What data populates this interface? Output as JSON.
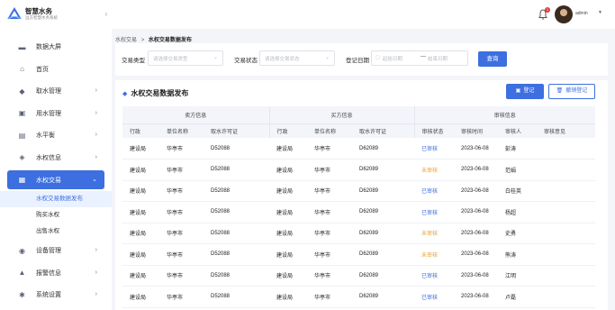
{
  "app": {
    "name": "智慧水务",
    "subtitle": "远方智慧水务系统"
  },
  "sidebar": {
    "items": [
      {
        "label": "数据大屏",
        "icon": "monitor-icon",
        "has_children": false
      },
      {
        "label": "首页",
        "icon": "home-icon",
        "has_children": false
      },
      {
        "label": "取水管理",
        "icon": "water-intake-icon",
        "has_children": true
      },
      {
        "label": "用水管理",
        "icon": "water-use-icon",
        "has_children": true
      },
      {
        "label": "水平衡",
        "icon": "balance-icon",
        "has_children": true
      },
      {
        "label": "水权信息",
        "icon": "water-rights-icon",
        "has_children": true
      },
      {
        "label": "水权交易",
        "icon": "trade-icon",
        "has_children": true,
        "active": true
      },
      {
        "label": "设备管理",
        "icon": "device-icon",
        "has_children": true
      },
      {
        "label": "报警信息",
        "icon": "alarm-icon",
        "has_children": true
      },
      {
        "label": "系统设置",
        "icon": "settings-icon",
        "has_children": true
      }
    ],
    "sub_items": [
      "水权交易数据发布",
      "购买水权",
      "出售水权"
    ]
  },
  "topbar": {
    "notification_count": "1",
    "user_name": "admin"
  },
  "breadcrumb": {
    "parent": "水权交易",
    "separator": ">",
    "current": "水权交易数据发布"
  },
  "filters": {
    "trade_type_label": "交易类型",
    "trade_type_placeholder": "请选择交易类型",
    "trade_status_label": "交易状态",
    "trade_status_placeholder": "请选择交易状态",
    "reg_date_label": "登记日期",
    "date_start_placeholder": "起始日期",
    "date_sep": "—",
    "date_end_placeholder": "结束日期",
    "query_label": "查询"
  },
  "panel": {
    "title": "水权交易数据发布",
    "register_label": "登记",
    "cancel_register_label": "撤销登记"
  },
  "table": {
    "group_headers": [
      "卖方信息",
      "买方信息",
      "审核信息"
    ],
    "columns": [
      "行政",
      "单位名称",
      "取水许可证",
      "行政",
      "单位名称",
      "取水许可证",
      "审核状态",
      "审核时间",
      "审核人",
      "审核意见"
    ],
    "rows": [
      [
        "建设局",
        "华亭市",
        "D52088",
        "建设局",
        "华亭市",
        "D62089",
        "已审核",
        "2023-06-08",
        "彭涛",
        ""
      ],
      [
        "建设局",
        "华亭市",
        "D52088",
        "建设局",
        "华亭市",
        "D62089",
        "未审核",
        "2023-06-08",
        "范娟",
        ""
      ],
      [
        "建设局",
        "华亭市",
        "D52088",
        "建设局",
        "华亭市",
        "D62089",
        "已审核",
        "2023-06-08",
        "白桂英",
        ""
      ],
      [
        "建设局",
        "华亭市",
        "D52088",
        "建设局",
        "华亭市",
        "D62089",
        "已审核",
        "2023-06-08",
        "杨超",
        ""
      ],
      [
        "建设局",
        "华亭市",
        "D52088",
        "建设局",
        "华亭市",
        "D62089",
        "未审核",
        "2023-06-08",
        "史勇",
        ""
      ],
      [
        "建设局",
        "华亭市",
        "D52088",
        "建设局",
        "华亭市",
        "D62089",
        "未审核",
        "2023-06-08",
        "熊涛",
        ""
      ],
      [
        "建设局",
        "华亭市",
        "D52088",
        "建设局",
        "华亭市",
        "D62089",
        "已审核",
        "2023-06-08",
        "江明",
        ""
      ],
      [
        "建设局",
        "华亭市",
        "D52088",
        "建设局",
        "华亭市",
        "D62089",
        "已审核",
        "2023-06-08",
        "卢磊",
        ""
      ]
    ]
  },
  "colors": {
    "accent": "#3d6fe0",
    "approved": "#3d6fe0",
    "pending": "#e6a23c"
  }
}
